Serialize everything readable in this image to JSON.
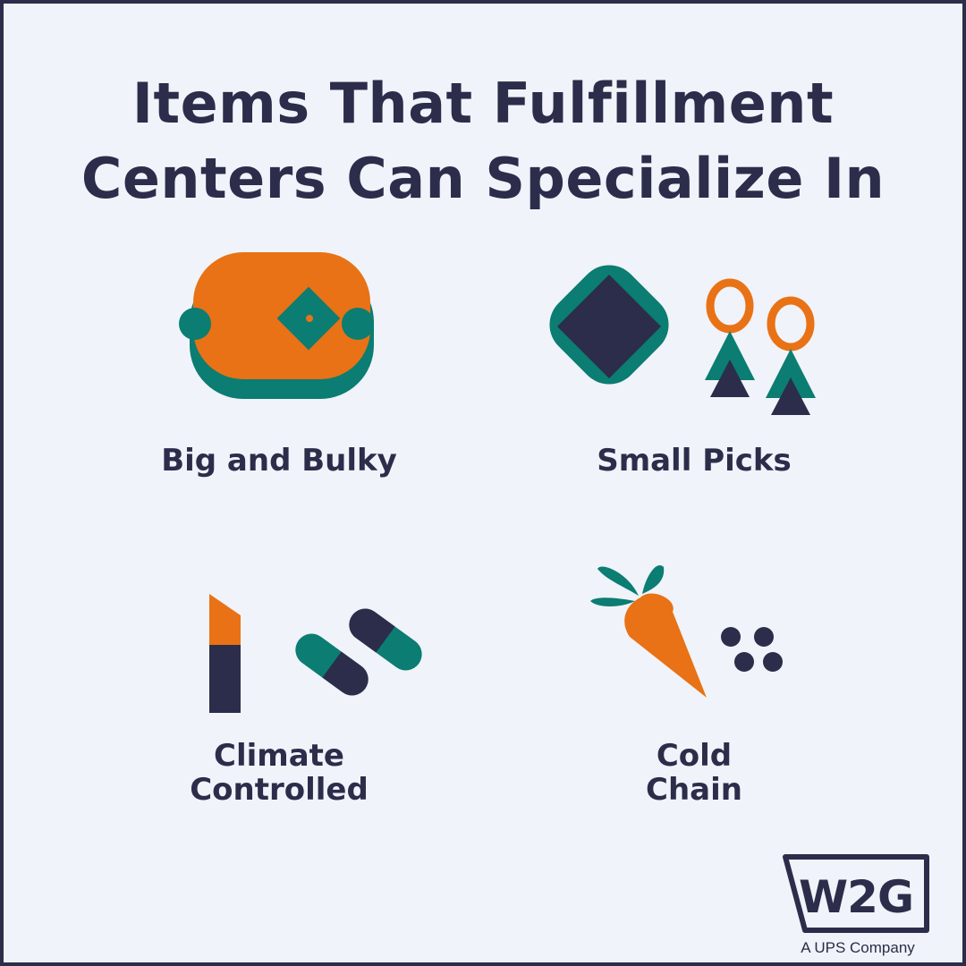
{
  "title": {
    "line1": "Items That Fulfillment",
    "line2": "Centers Can Specialize In"
  },
  "items": [
    {
      "label": "Big and Bulky",
      "icon": "sofa-icon"
    },
    {
      "label": "Small Picks",
      "icon": "jewelry-icon"
    },
    {
      "label_line1": "Climate",
      "label_line2": "Controlled",
      "icon": "lipstick-pills-icon"
    },
    {
      "label_line1": "Cold",
      "label_line2": "Chain",
      "icon": "carrot-icon"
    }
  ],
  "logo": {
    "text": "W2G",
    "tagline": "A UPS Company"
  },
  "colors": {
    "navy": "#2b2d4a",
    "orange": "#e87215",
    "teal": "#0b7d72",
    "background": "#f0f3f9"
  }
}
